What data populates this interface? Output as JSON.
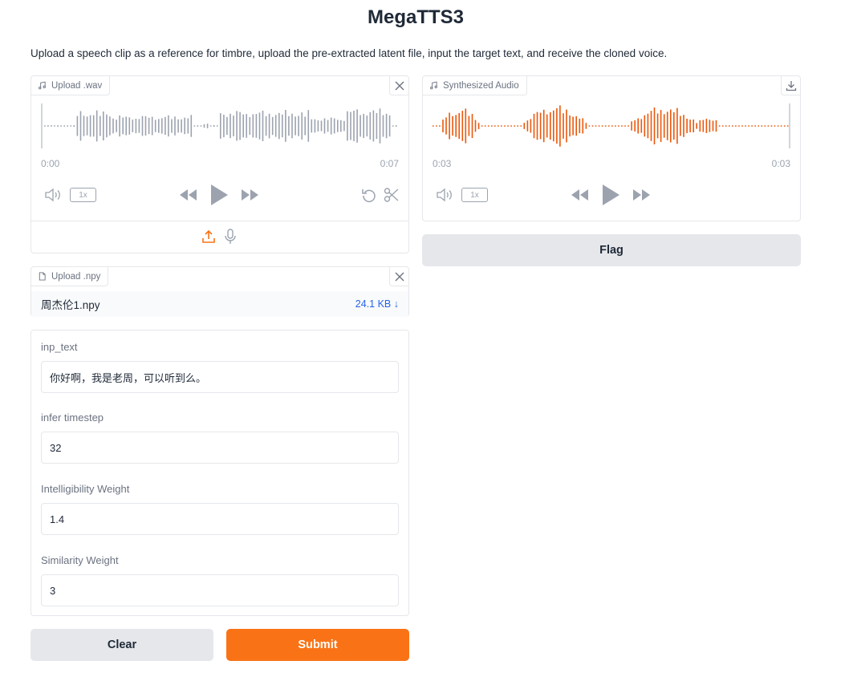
{
  "app": {
    "title": "MegaTTS3",
    "description": "Upload a speech clip as a reference for timbre, upload the pre-extracted latent file, input the target text, and receive the cloned voice."
  },
  "input_audio": {
    "label": "Upload .wav",
    "time_start": "0:00",
    "time_end": "0:07",
    "playback_rate": "1x"
  },
  "output_audio": {
    "label": "Synthesized Audio",
    "time_start": "0:03",
    "time_end": "0:03",
    "playback_rate": "1x"
  },
  "flag_button": {
    "label": "Flag"
  },
  "npy_file": {
    "label": "Upload .npy",
    "filename": "周杰伦1.npy",
    "size": "24.1 KB ↓"
  },
  "fields": {
    "inp_text": {
      "label": "inp_text",
      "value": "你好啊，我是老周，可以听到么。"
    },
    "infer_timestep": {
      "label": "infer timestep",
      "value": "32"
    },
    "intelligibility_weight": {
      "label": "Intelligibility Weight",
      "value": "1.4"
    },
    "similarity_weight": {
      "label": "Similarity Weight",
      "value": "3"
    }
  },
  "actions": {
    "clear_label": "Clear",
    "submit_label": "Submit"
  },
  "colors": {
    "accent": "#f97316",
    "waveform_input": "#9ca3af",
    "waveform_output": "#ea580c",
    "link": "#2563eb"
  },
  "icons": [
    "music-note-icon",
    "close-icon",
    "download-icon",
    "volume-icon",
    "rewind-icon",
    "play-icon",
    "fast-forward-icon",
    "undo-icon",
    "scissors-icon",
    "upload-icon",
    "microphone-icon",
    "file-icon"
  ]
}
